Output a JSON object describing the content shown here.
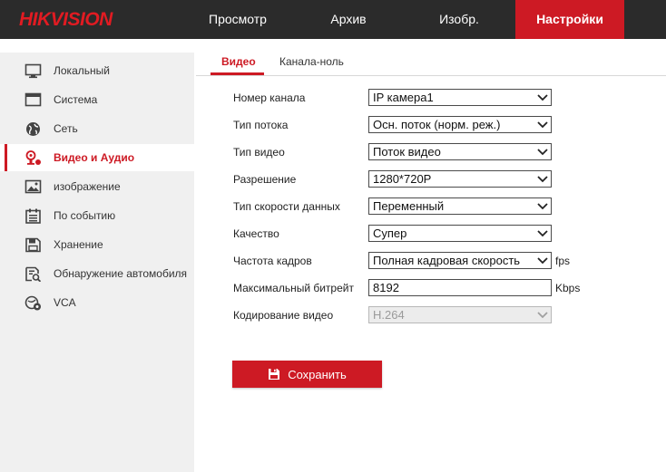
{
  "brand": {
    "logo_text": "HIKVISION",
    "accent_color": "#cd1a24"
  },
  "nav": {
    "items": [
      {
        "label": "Просмотр"
      },
      {
        "label": "Архив"
      },
      {
        "label": "Изобр."
      },
      {
        "label": "Настройки",
        "active": true
      }
    ]
  },
  "sidebar": {
    "items": [
      {
        "label": "Локальный",
        "icon": "monitor-icon"
      },
      {
        "label": "Система",
        "icon": "system-window-icon"
      },
      {
        "label": "Сеть",
        "icon": "globe-icon"
      },
      {
        "label": "Видео и Аудио",
        "icon": "video-audio-icon",
        "active": true
      },
      {
        "label": "изображение",
        "icon": "image-icon"
      },
      {
        "label": "По событию",
        "icon": "event-calendar-icon"
      },
      {
        "label": "Хранение",
        "icon": "storage-icon"
      },
      {
        "label": "Обнаружение автомобиля",
        "icon": "vehicle-detection-icon"
      },
      {
        "label": "VCA",
        "icon": "vca-icon"
      }
    ]
  },
  "tabs": [
    {
      "label": "Видео",
      "active": true
    },
    {
      "label": "Канала-ноль"
    }
  ],
  "form": {
    "channel_no": {
      "label": "Номер канала",
      "value": "IP камера1"
    },
    "stream_type": {
      "label": "Тип потока",
      "value": "Осн. поток (норм. реж.)"
    },
    "video_type": {
      "label": "Тип видео",
      "value": "Поток видео"
    },
    "resolution": {
      "label": "Разрешение",
      "value": "1280*720P"
    },
    "bitrate_type": {
      "label": "Тип скорости данных",
      "value": "Переменный"
    },
    "quality": {
      "label": "Качество",
      "value": "Супер"
    },
    "frame_rate": {
      "label": "Частота кадров",
      "value": "Полная кадровая скорость",
      "unit": "fps"
    },
    "max_bitrate": {
      "label": "Максимальный битрейт",
      "value": "8192",
      "unit": "Kbps"
    },
    "video_encoding": {
      "label": "Кодирование видео",
      "value": "H.264",
      "disabled": true
    }
  },
  "actions": {
    "save_label": "Сохранить"
  }
}
